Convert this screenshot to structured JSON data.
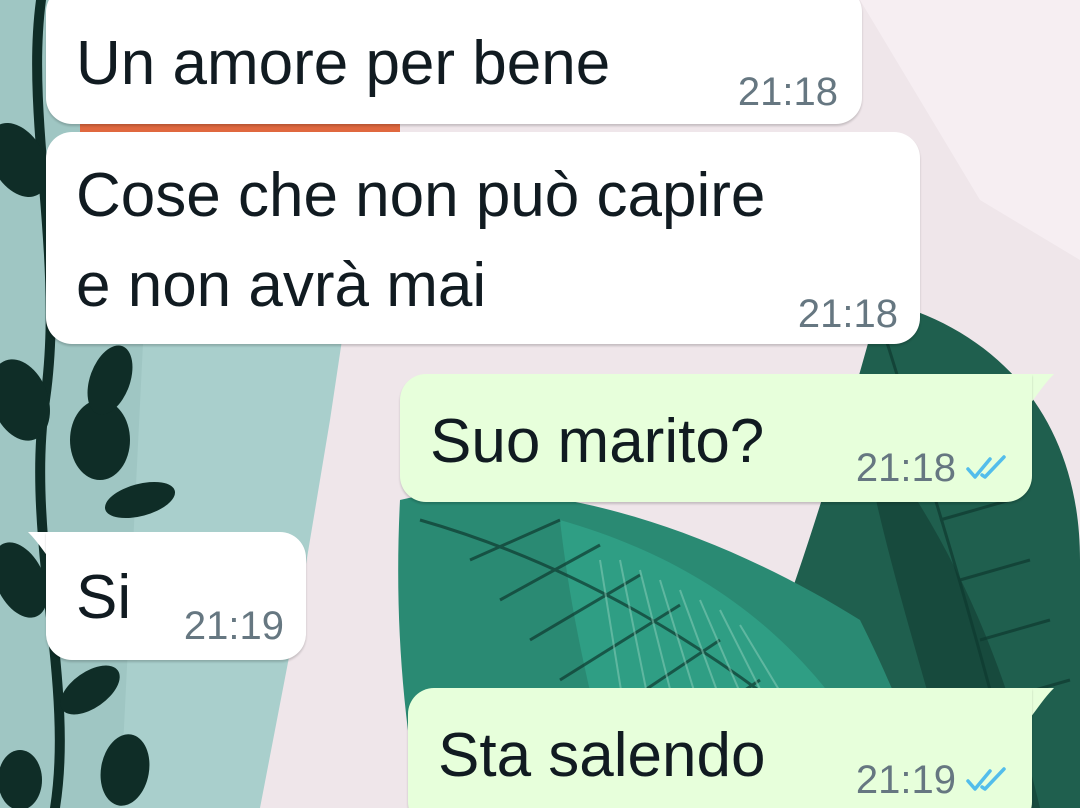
{
  "colors": {
    "incoming_bubble": "#ffffff",
    "outgoing_bubble": "#e7ffdb",
    "text": "#111b21",
    "timestamp": "#667781",
    "read_ticks": "#53bdeb"
  },
  "messages": [
    {
      "direction": "incoming",
      "text_lines": [
        "Un amore per bene"
      ],
      "time": "21:18"
    },
    {
      "direction": "incoming",
      "text_lines": [
        "Cose che non può capire",
        "e non avrà mai"
      ],
      "time": "21:18"
    },
    {
      "direction": "outgoing",
      "text_lines": [
        "Suo marito?"
      ],
      "time": "21:18",
      "status_icon": "double-check-read-icon"
    },
    {
      "direction": "incoming",
      "text_lines": [
        "Si"
      ],
      "time": "21:19"
    },
    {
      "direction": "outgoing",
      "text_lines": [
        "Sta salendo"
      ],
      "time": "21:19",
      "status_icon": "double-check-read-icon"
    }
  ]
}
